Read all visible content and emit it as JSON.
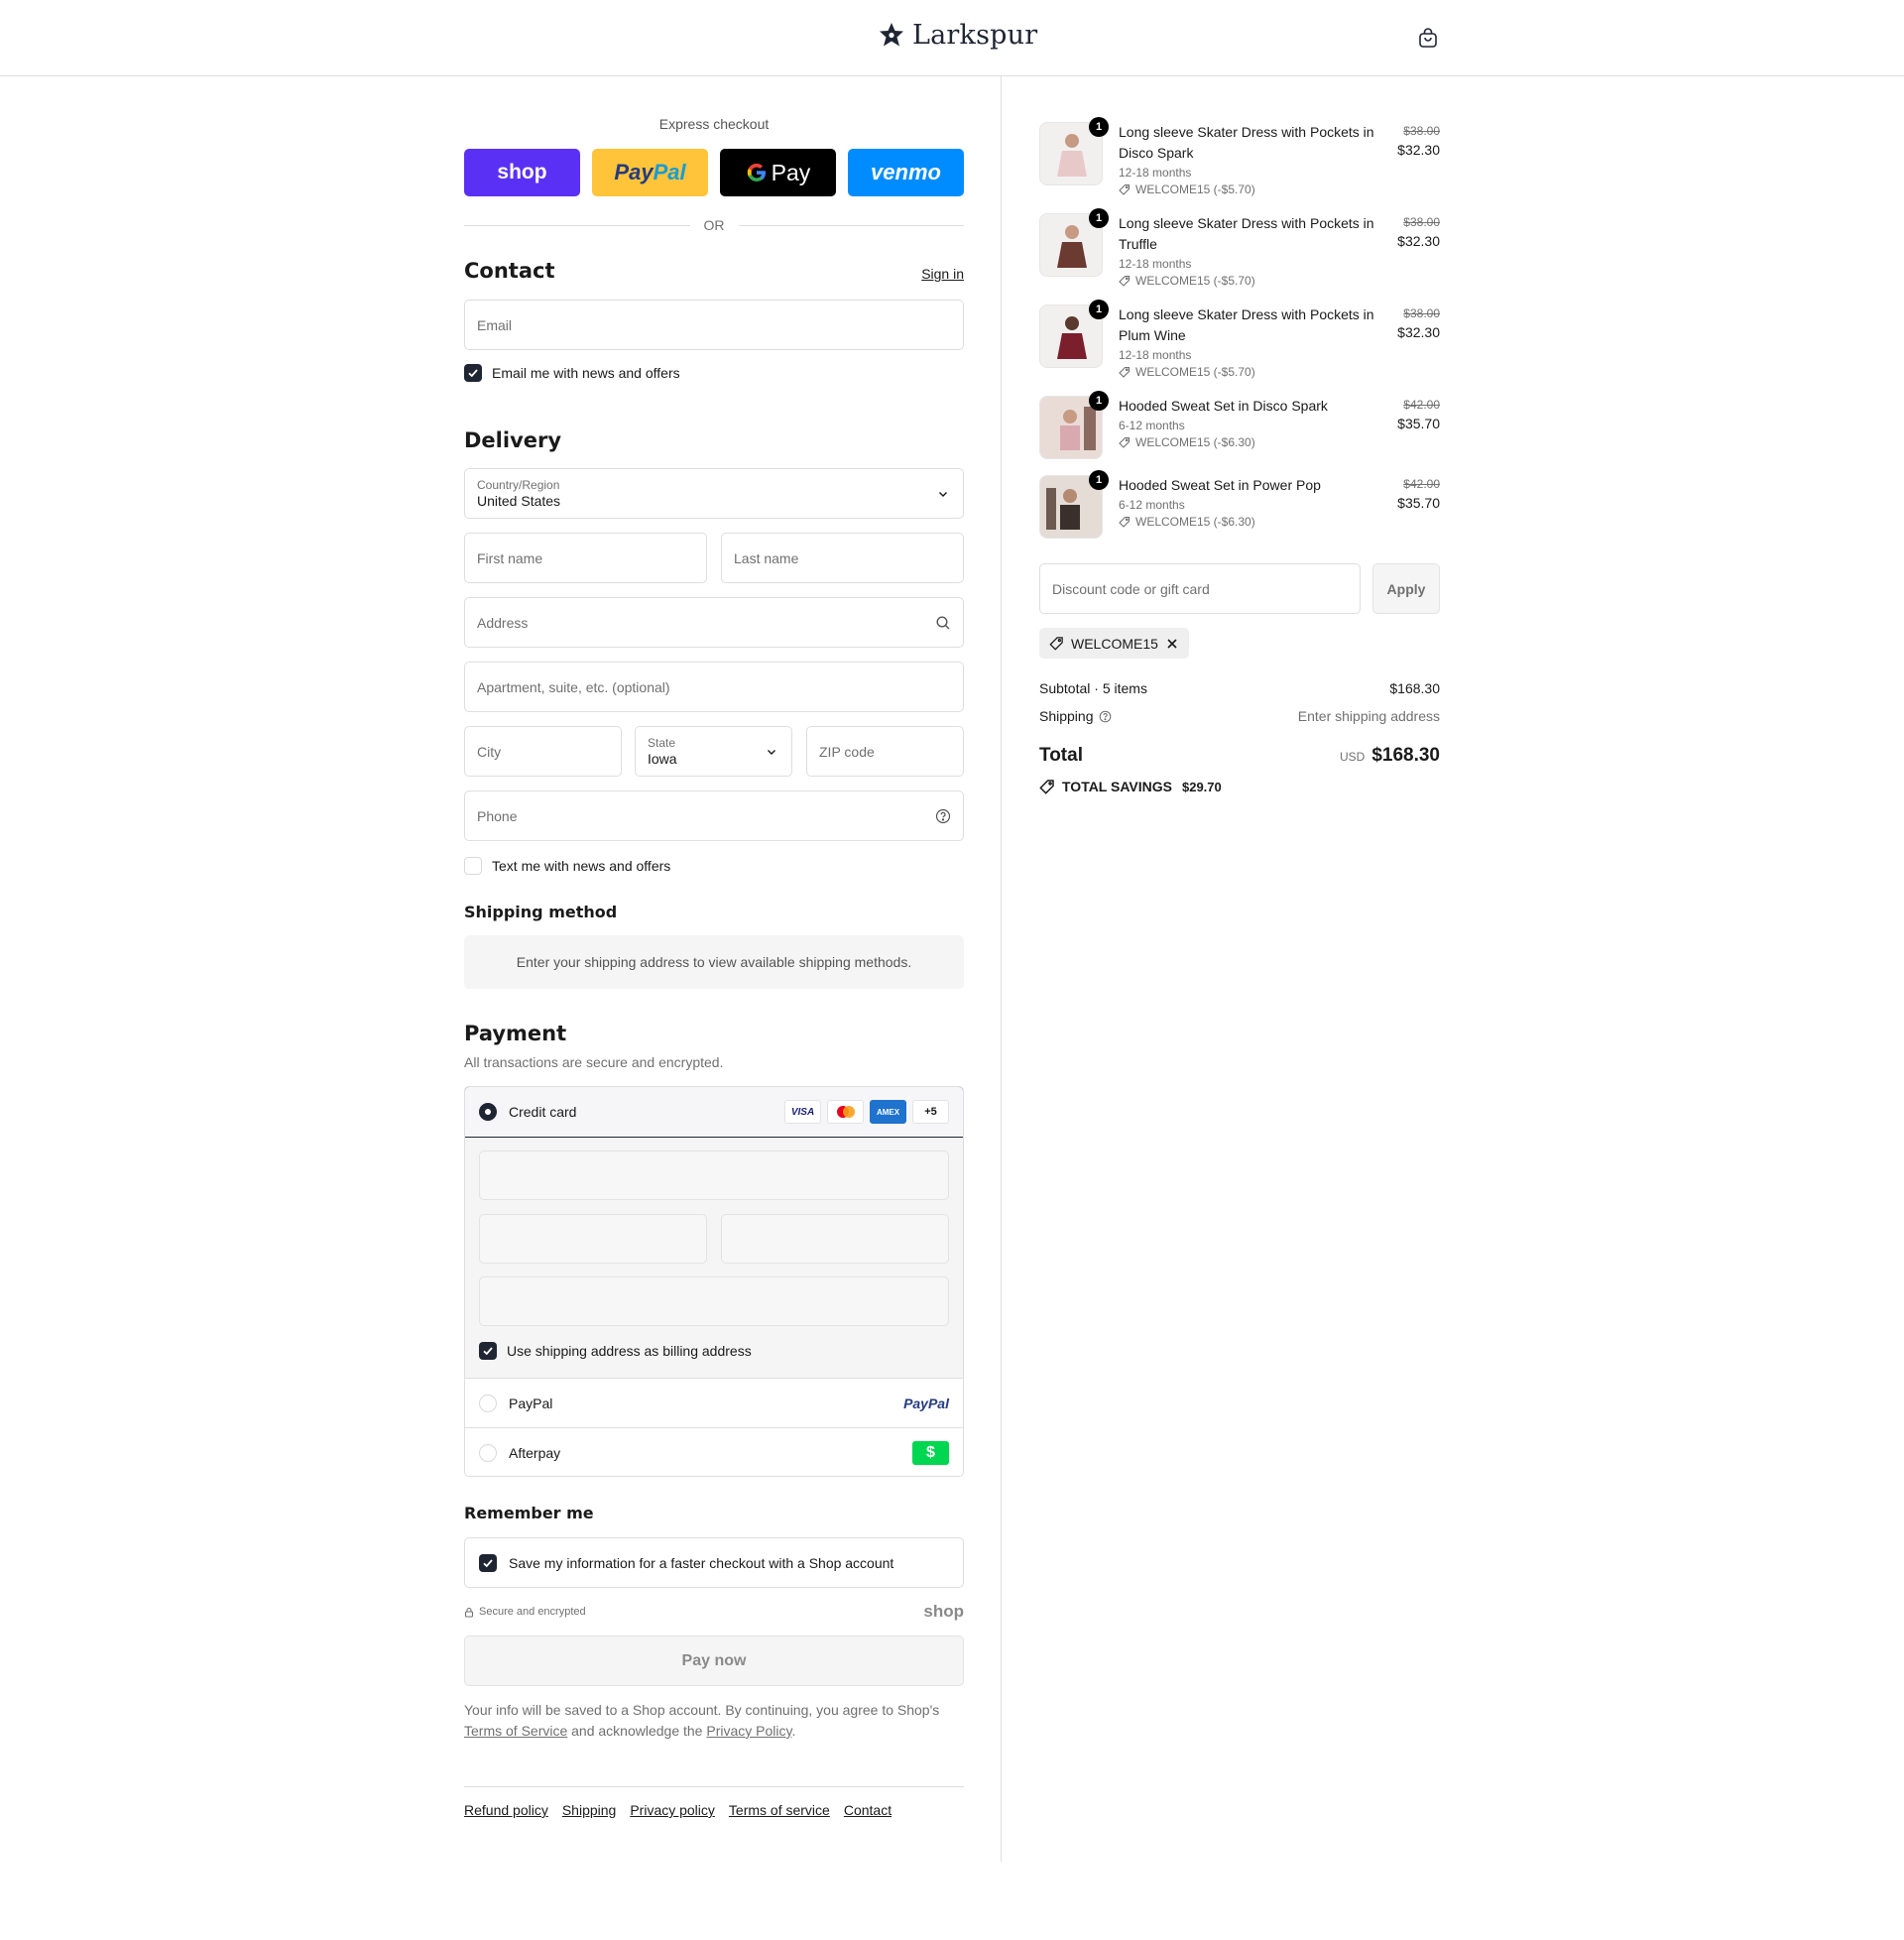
{
  "header": {
    "brand": "Larkspur"
  },
  "express": {
    "label": "Express checkout",
    "buttons": [
      "shop",
      "PayPal",
      "G Pay",
      "venmo"
    ],
    "or": "OR"
  },
  "contact": {
    "title": "Contact",
    "sign_in": "Sign in",
    "email_placeholder": "Email",
    "newsletter_label": "Email me with news and offers",
    "newsletter_checked": true
  },
  "delivery": {
    "title": "Delivery",
    "country_label": "Country/Region",
    "country_value": "United States",
    "first_name": "First name",
    "last_name": "Last name",
    "address": "Address",
    "apartment": "Apartment, suite, etc. (optional)",
    "city": "City",
    "state_label": "State",
    "state_value": "Iowa",
    "zip": "ZIP code",
    "phone": "Phone",
    "sms_label": "Text me with news and offers",
    "sms_checked": false
  },
  "shipping_method": {
    "title": "Shipping method",
    "message": "Enter your shipping address to view available shipping methods."
  },
  "payment": {
    "title": "Payment",
    "subtitle": "All transactions are secure and encrypted.",
    "credit_card_label": "Credit card",
    "card_brands": [
      "VISA",
      "Mastercard",
      "AMEX"
    ],
    "more_cards": "+5",
    "billing_label": "Use shipping address as billing address",
    "billing_checked": true,
    "paypal_label": "PayPal",
    "paypal_logo": "PayPal",
    "afterpay_label": "Afterpay",
    "afterpay_logo": "$"
  },
  "remember": {
    "title": "Remember me",
    "save_label": "Save my information for a faster checkout with a Shop account",
    "save_checked": true,
    "secure_label": "Secure and encrypted",
    "shop_mark": "shop"
  },
  "pay_now": "Pay now",
  "legal": {
    "text_1": "Your info will be saved to a Shop account. By continuing, you agree to Shop's",
    "tos": "Terms of Service",
    "text_2": "and acknowledge the",
    "privacy": "Privacy Policy",
    "text_3": "."
  },
  "footer_links": [
    "Refund policy",
    "Shipping",
    "Privacy policy",
    "Terms of service",
    "Contact"
  ],
  "order": {
    "items": [
      {
        "qty": "1",
        "name": "Long sleeve Skater Dress with Pockets in Disco Spark",
        "variant": "12-18 months",
        "discount": "WELCOME15 (-$5.70)",
        "old_price": "$38.00",
        "price": "$32.30",
        "color": "#e8c9c9"
      },
      {
        "qty": "1",
        "name": "Long sleeve Skater Dress with Pockets in Truffle",
        "variant": "12-18 months",
        "discount": "WELCOME15 (-$5.70)",
        "old_price": "$38.00",
        "price": "$32.30",
        "color": "#6b3a30"
      },
      {
        "qty": "1",
        "name": "Long sleeve Skater Dress with Pockets in Plum Wine",
        "variant": "12-18 months",
        "discount": "WELCOME15 (-$5.70)",
        "old_price": "$38.00",
        "price": "$32.30",
        "color": "#7c1f2c"
      },
      {
        "qty": "1",
        "name": "Hooded Sweat Set in Disco Spark",
        "variant": "6-12 months",
        "discount": "WELCOME15 (-$6.30)",
        "old_price": "$42.00",
        "price": "$35.70",
        "color": "#d9a9b0"
      },
      {
        "qty": "1",
        "name": "Hooded Sweat Set in Power Pop",
        "variant": "6-12 months",
        "discount": "WELCOME15 (-$6.30)",
        "old_price": "$42.00",
        "price": "$35.70",
        "color": "#3b2f2b"
      }
    ],
    "discount_placeholder": "Discount code or gift card",
    "apply": "Apply",
    "applied_code": "WELCOME15",
    "subtotal_label": "Subtotal · 5 items",
    "subtotal_value": "$168.30",
    "shipping_label": "Shipping",
    "shipping_value": "Enter shipping address",
    "total_label": "Total",
    "currency": "USD",
    "total_value": "$168.30",
    "savings_label": "TOTAL SAVINGS",
    "savings_value": "$29.70"
  },
  "colors": {
    "shop_purple": "#5a31f4",
    "paypal_yellow": "#ffc439",
    "venmo_blue": "#008cff",
    "dark": "#1f2533",
    "afterpay_green": "#00d64f"
  }
}
